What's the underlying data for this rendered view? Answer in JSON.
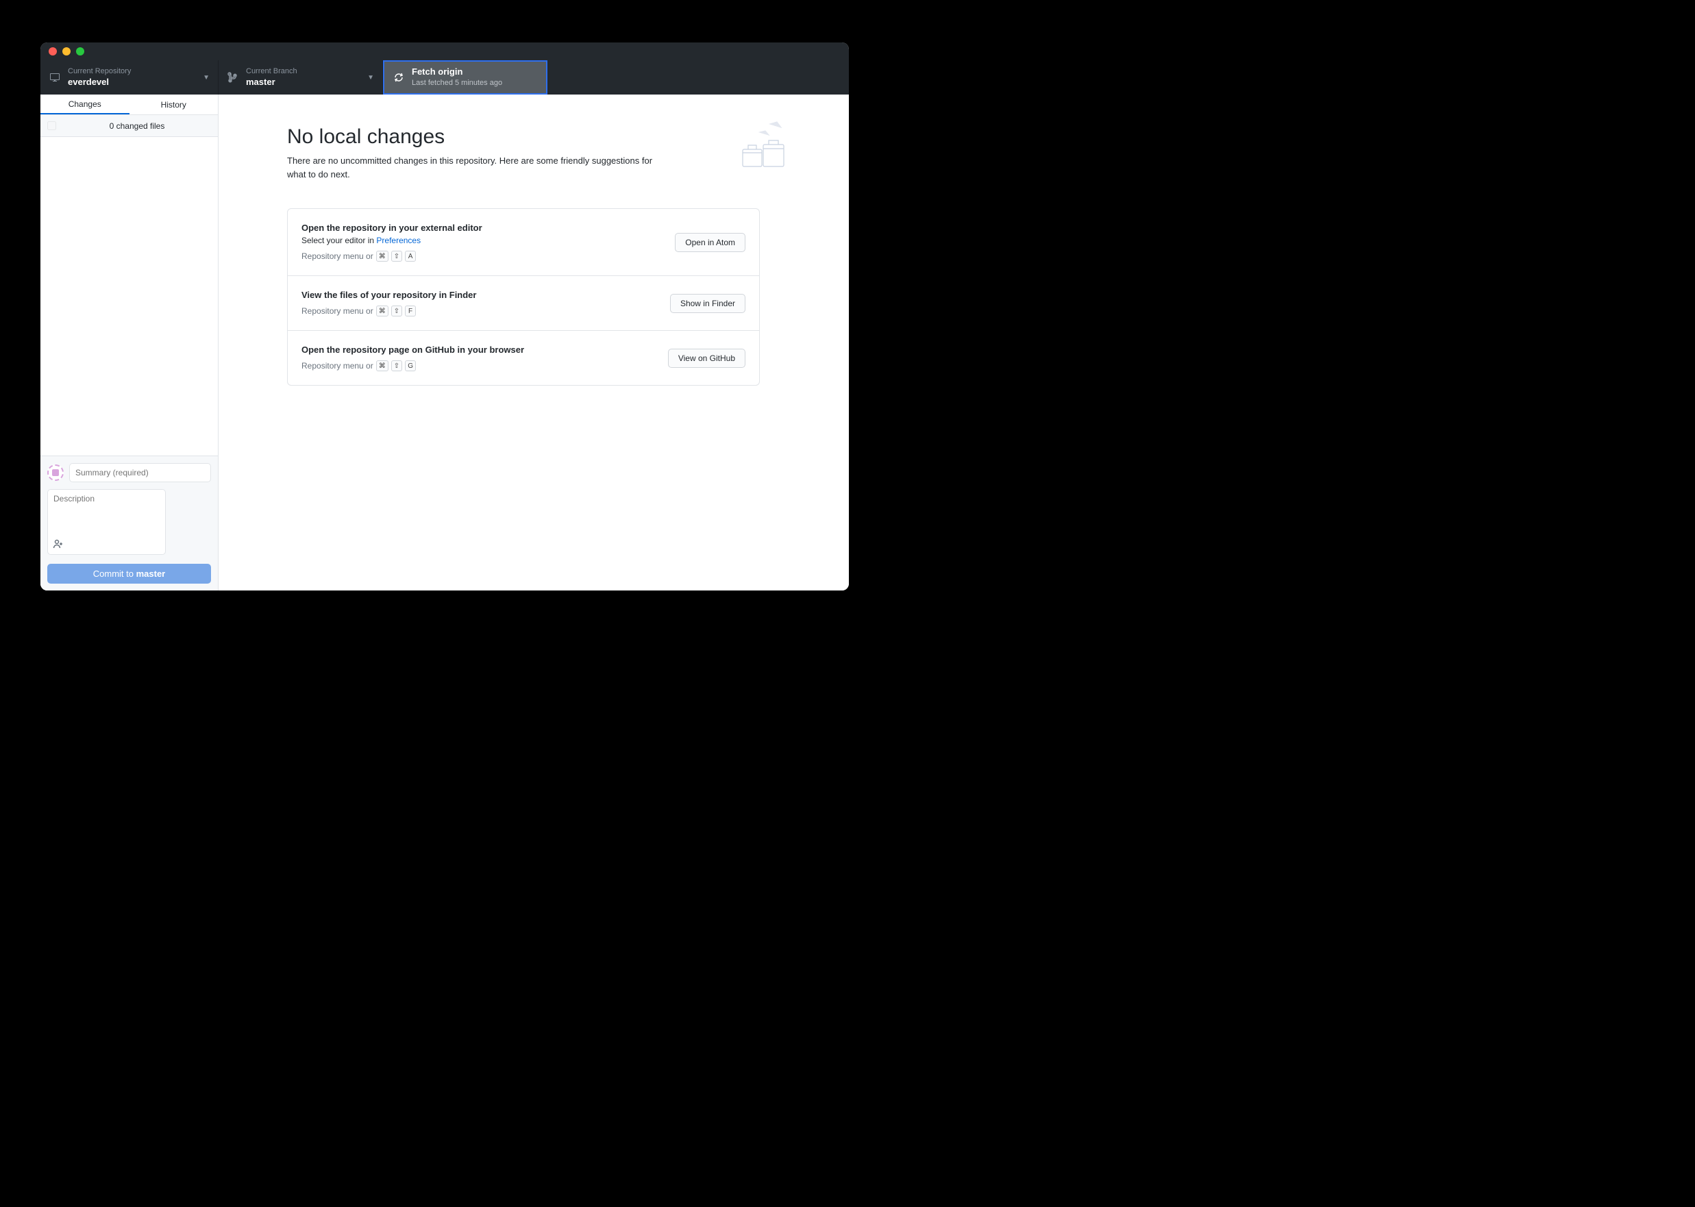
{
  "toolbar": {
    "repo": {
      "label": "Current Repository",
      "value": "everdevel"
    },
    "branch": {
      "label": "Current Branch",
      "value": "master"
    },
    "fetch": {
      "label": "Fetch origin",
      "sub": "Last fetched 5 minutes ago"
    }
  },
  "sidebar": {
    "tabs": {
      "changes": "Changes",
      "history": "History"
    },
    "changes_count": "0 changed files",
    "summary_placeholder": "Summary (required)",
    "description_placeholder": "Description",
    "commit_prefix": "Commit to ",
    "commit_branch": "master"
  },
  "main": {
    "title": "No local changes",
    "subtitle": "There are no uncommitted changes in this repository. Here are some friendly suggestions for what to do next.",
    "suggestions": [
      {
        "title": "Open the repository in your external editor",
        "sub_prefix": "Select your editor in ",
        "sub_link": "Preferences",
        "hint": "Repository menu or",
        "keys": [
          "⌘",
          "⇧",
          "A"
        ],
        "button": "Open in Atom"
      },
      {
        "title": "View the files of your repository in Finder",
        "sub_prefix": "",
        "sub_link": "",
        "hint": "Repository menu or",
        "keys": [
          "⌘",
          "⇧",
          "F"
        ],
        "button": "Show in Finder"
      },
      {
        "title": "Open the repository page on GitHub in your browser",
        "sub_prefix": "",
        "sub_link": "",
        "hint": "Repository menu or",
        "keys": [
          "⌘",
          "⇧",
          "G"
        ],
        "button": "View on GitHub"
      }
    ]
  }
}
